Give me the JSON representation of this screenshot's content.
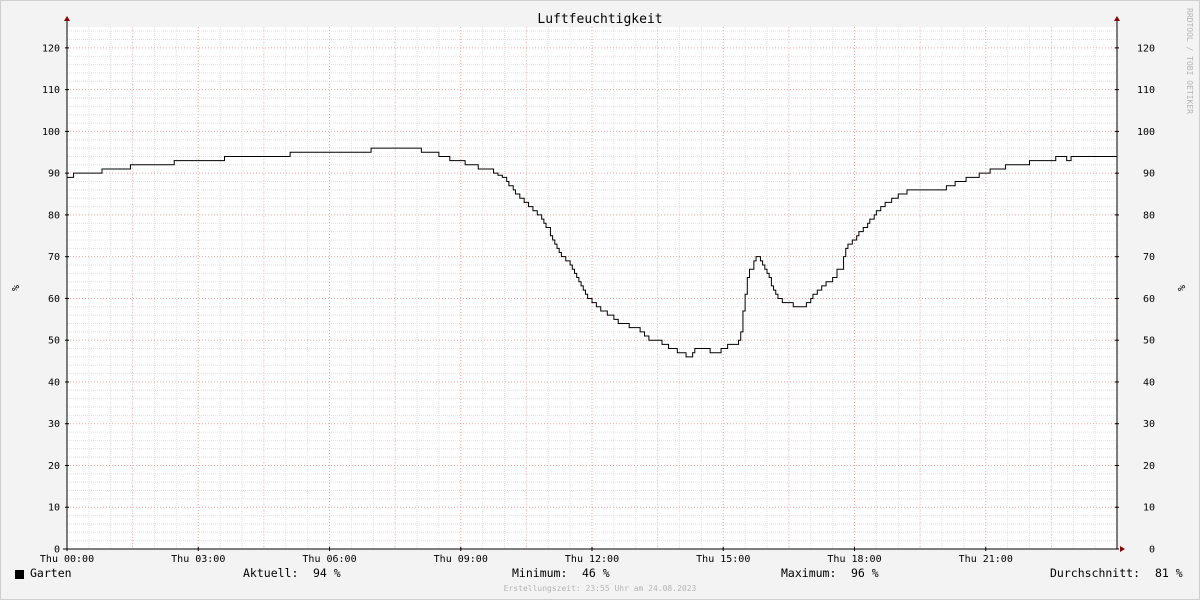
{
  "chart_data": {
    "type": "line",
    "title": "Luftfeuchtigkeit",
    "ylabel": "%",
    "ylabel_right": "%",
    "ylim": [
      0,
      125
    ],
    "yticks": [
      0,
      10,
      20,
      30,
      40,
      50,
      60,
      70,
      80,
      90,
      100,
      110,
      120
    ],
    "xlim_hours": [
      0,
      24
    ],
    "xticks": [
      {
        "hour": 0,
        "label": "Thu 00:00"
      },
      {
        "hour": 3,
        "label": "Thu 03:00"
      },
      {
        "hour": 6,
        "label": "Thu 06:00"
      },
      {
        "hour": 9,
        "label": "Thu 09:00"
      },
      {
        "hour": 12,
        "label": "Thu 12:00"
      },
      {
        "hour": 15,
        "label": "Thu 15:00"
      },
      {
        "hour": 18,
        "label": "Thu 18:00"
      },
      {
        "hour": 21,
        "label": "Thu 21:00"
      }
    ],
    "grid": true,
    "series": [
      {
        "name": "Garten",
        "color": "#000000",
        "step": true,
        "points": [
          [
            0.0,
            89
          ],
          [
            0.15,
            90
          ],
          [
            0.8,
            91
          ],
          [
            1.45,
            92
          ],
          [
            2.45,
            93
          ],
          [
            3.6,
            94
          ],
          [
            5.1,
            95
          ],
          [
            6.95,
            96
          ],
          [
            8.1,
            95
          ],
          [
            8.5,
            94
          ],
          [
            8.75,
            93
          ],
          [
            9.1,
            92
          ],
          [
            9.4,
            91
          ],
          [
            9.75,
            90
          ],
          [
            9.85,
            89.5
          ],
          [
            9.95,
            89
          ],
          [
            10.05,
            88
          ],
          [
            10.1,
            87
          ],
          [
            10.2,
            86
          ],
          [
            10.25,
            85
          ],
          [
            10.35,
            84
          ],
          [
            10.45,
            83
          ],
          [
            10.55,
            82
          ],
          [
            10.65,
            81
          ],
          [
            10.75,
            80
          ],
          [
            10.85,
            79
          ],
          [
            10.9,
            78
          ],
          [
            10.95,
            77
          ],
          [
            11.05,
            75
          ],
          [
            11.1,
            74
          ],
          [
            11.15,
            73
          ],
          [
            11.2,
            72
          ],
          [
            11.25,
            71
          ],
          [
            11.3,
            70
          ],
          [
            11.4,
            69
          ],
          [
            11.5,
            68
          ],
          [
            11.55,
            67
          ],
          [
            11.6,
            66
          ],
          [
            11.65,
            65
          ],
          [
            11.7,
            64
          ],
          [
            11.75,
            63
          ],
          [
            11.8,
            62
          ],
          [
            11.85,
            61
          ],
          [
            11.9,
            60
          ],
          [
            12.0,
            59
          ],
          [
            12.1,
            58
          ],
          [
            12.2,
            57
          ],
          [
            12.35,
            56
          ],
          [
            12.5,
            55
          ],
          [
            12.6,
            54
          ],
          [
            12.85,
            53
          ],
          [
            13.1,
            52
          ],
          [
            13.2,
            51
          ],
          [
            13.3,
            50
          ],
          [
            13.6,
            49
          ],
          [
            13.75,
            48
          ],
          [
            13.95,
            47
          ],
          [
            14.15,
            46
          ],
          [
            14.3,
            47
          ],
          [
            14.35,
            48
          ],
          [
            14.7,
            47
          ],
          [
            14.95,
            48
          ],
          [
            15.1,
            49
          ],
          [
            15.35,
            50
          ],
          [
            15.4,
            52
          ],
          [
            15.45,
            57
          ],
          [
            15.5,
            61
          ],
          [
            15.55,
            65
          ],
          [
            15.6,
            67
          ],
          [
            15.7,
            69
          ],
          [
            15.75,
            70
          ],
          [
            15.85,
            69
          ],
          [
            15.9,
            68
          ],
          [
            15.95,
            67
          ],
          [
            16.0,
            66
          ],
          [
            16.05,
            65
          ],
          [
            16.1,
            63
          ],
          [
            16.15,
            62
          ],
          [
            16.2,
            61
          ],
          [
            16.25,
            60
          ],
          [
            16.35,
            59
          ],
          [
            16.6,
            58
          ],
          [
            16.9,
            59
          ],
          [
            17.0,
            60
          ],
          [
            17.05,
            61
          ],
          [
            17.15,
            62
          ],
          [
            17.25,
            63
          ],
          [
            17.35,
            64
          ],
          [
            17.5,
            65
          ],
          [
            17.6,
            67
          ],
          [
            17.75,
            70
          ],
          [
            17.8,
            72
          ],
          [
            17.85,
            73
          ],
          [
            17.95,
            74
          ],
          [
            18.05,
            75
          ],
          [
            18.1,
            76
          ],
          [
            18.2,
            77
          ],
          [
            18.3,
            78
          ],
          [
            18.35,
            79
          ],
          [
            18.45,
            80
          ],
          [
            18.5,
            81
          ],
          [
            18.6,
            82
          ],
          [
            18.7,
            83
          ],
          [
            18.85,
            84
          ],
          [
            19.0,
            85
          ],
          [
            19.2,
            86
          ],
          [
            20.1,
            87
          ],
          [
            20.3,
            88
          ],
          [
            20.55,
            89
          ],
          [
            20.85,
            90
          ],
          [
            21.1,
            91
          ],
          [
            21.45,
            92
          ],
          [
            22.0,
            93
          ],
          [
            22.6,
            94
          ],
          [
            22.85,
            93
          ],
          [
            22.95,
            94
          ],
          [
            24.0,
            94
          ]
        ]
      }
    ]
  },
  "watermark": "RRDTOOL / TOBI OETIKER",
  "legend": {
    "series_name": "Garten",
    "aktuell_label": "Aktuell:",
    "aktuell_value": "94 %",
    "minimum_label": "Minimum:",
    "minimum_value": "46 %",
    "maximum_label": "Maximum:",
    "maximum_value": "96 %",
    "durchschnitt_label": "Durchschnitt:",
    "durchschnitt_value": "81 %"
  },
  "timestamp": "Erstellungszeit: 23:55 Uhr am 24.08.2023"
}
